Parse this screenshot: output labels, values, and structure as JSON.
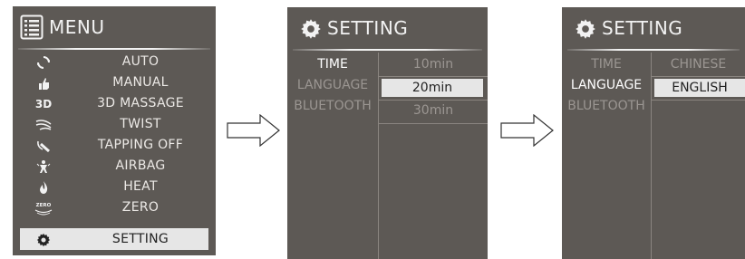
{
  "menu_screen": {
    "title": "MENU",
    "items": [
      {
        "label": "AUTO",
        "icon": "auto-cycle-icon"
      },
      {
        "label": "MANUAL",
        "icon": "hand-icon"
      },
      {
        "label": "3D MASSAGE",
        "icon": "3d-icon",
        "icon_text": "3D"
      },
      {
        "label": "TWIST",
        "icon": "twist-icon"
      },
      {
        "label": "TAPPING OFF",
        "icon": "tapping-icon"
      },
      {
        "label": "AIRBAG",
        "icon": "airbag-icon"
      },
      {
        "label": "HEAT",
        "icon": "heat-icon"
      },
      {
        "label": "ZERO",
        "icon": "zero-gravity-icon",
        "icon_text": "ZERO"
      },
      {
        "label": "SETTING",
        "icon": "gear-icon",
        "selected": true
      }
    ]
  },
  "setting_time_screen": {
    "title": "SETTING",
    "categories": [
      "TIME",
      "LANGUAGE",
      "BLUETOOTH"
    ],
    "active_category": "TIME",
    "values": [
      "10min",
      "20min",
      "30min"
    ],
    "selected_value": "20min"
  },
  "setting_language_screen": {
    "title": "SETTING",
    "categories": [
      "TIME",
      "LANGUAGE",
      "BLUETOOTH"
    ],
    "active_category": "LANGUAGE",
    "values": [
      "CHINESE",
      "ENGLISH"
    ],
    "selected_value": "ENGLISH"
  },
  "colors": {
    "screen_bg": "#5d5955",
    "highlight": "#e6e6e6",
    "inactive_text": "#9b9692"
  }
}
